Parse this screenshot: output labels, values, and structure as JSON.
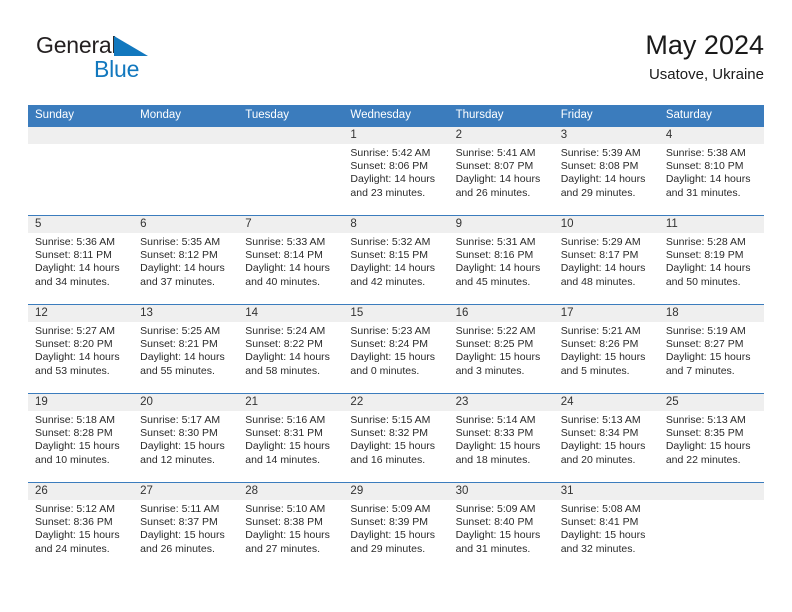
{
  "brand": {
    "name_part1": "General",
    "name_part2": "Blue",
    "triangle_color": "#1278be"
  },
  "header": {
    "title": "May 2024",
    "subtitle": "Usatove, Ukraine"
  },
  "colors": {
    "header_blue": "#3b7cbd",
    "day_number_band": "#efefef",
    "brand_blue": "#1278be",
    "text": "#222222"
  },
  "weekdays": [
    "Sunday",
    "Monday",
    "Tuesday",
    "Wednesday",
    "Thursday",
    "Friday",
    "Saturday"
  ],
  "labels": {
    "sunrise": "Sunrise:",
    "sunset": "Sunset:",
    "daylight": "Daylight:"
  },
  "weeks": [
    [
      {
        "day": "",
        "sunrise": "",
        "sunset": "",
        "daylight_line1": "",
        "daylight_line2": "",
        "empty": true
      },
      {
        "day": "",
        "sunrise": "",
        "sunset": "",
        "daylight_line1": "",
        "daylight_line2": "",
        "empty": true
      },
      {
        "day": "",
        "sunrise": "",
        "sunset": "",
        "daylight_line1": "",
        "daylight_line2": "",
        "empty": true
      },
      {
        "day": "1",
        "sunrise": "Sunrise: 5:42 AM",
        "sunset": "Sunset: 8:06 PM",
        "daylight_line1": "Daylight: 14 hours",
        "daylight_line2": "and 23 minutes.",
        "empty": false
      },
      {
        "day": "2",
        "sunrise": "Sunrise: 5:41 AM",
        "sunset": "Sunset: 8:07 PM",
        "daylight_line1": "Daylight: 14 hours",
        "daylight_line2": "and 26 minutes.",
        "empty": false
      },
      {
        "day": "3",
        "sunrise": "Sunrise: 5:39 AM",
        "sunset": "Sunset: 8:08 PM",
        "daylight_line1": "Daylight: 14 hours",
        "daylight_line2": "and 29 minutes.",
        "empty": false
      },
      {
        "day": "4",
        "sunrise": "Sunrise: 5:38 AM",
        "sunset": "Sunset: 8:10 PM",
        "daylight_line1": "Daylight: 14 hours",
        "daylight_line2": "and 31 minutes.",
        "empty": false
      }
    ],
    [
      {
        "day": "5",
        "sunrise": "Sunrise: 5:36 AM",
        "sunset": "Sunset: 8:11 PM",
        "daylight_line1": "Daylight: 14 hours",
        "daylight_line2": "and 34 minutes.",
        "empty": false
      },
      {
        "day": "6",
        "sunrise": "Sunrise: 5:35 AM",
        "sunset": "Sunset: 8:12 PM",
        "daylight_line1": "Daylight: 14 hours",
        "daylight_line2": "and 37 minutes.",
        "empty": false
      },
      {
        "day": "7",
        "sunrise": "Sunrise: 5:33 AM",
        "sunset": "Sunset: 8:14 PM",
        "daylight_line1": "Daylight: 14 hours",
        "daylight_line2": "and 40 minutes.",
        "empty": false
      },
      {
        "day": "8",
        "sunrise": "Sunrise: 5:32 AM",
        "sunset": "Sunset: 8:15 PM",
        "daylight_line1": "Daylight: 14 hours",
        "daylight_line2": "and 42 minutes.",
        "empty": false
      },
      {
        "day": "9",
        "sunrise": "Sunrise: 5:31 AM",
        "sunset": "Sunset: 8:16 PM",
        "daylight_line1": "Daylight: 14 hours",
        "daylight_line2": "and 45 minutes.",
        "empty": false
      },
      {
        "day": "10",
        "sunrise": "Sunrise: 5:29 AM",
        "sunset": "Sunset: 8:17 PM",
        "daylight_line1": "Daylight: 14 hours",
        "daylight_line2": "and 48 minutes.",
        "empty": false
      },
      {
        "day": "11",
        "sunrise": "Sunrise: 5:28 AM",
        "sunset": "Sunset: 8:19 PM",
        "daylight_line1": "Daylight: 14 hours",
        "daylight_line2": "and 50 minutes.",
        "empty": false
      }
    ],
    [
      {
        "day": "12",
        "sunrise": "Sunrise: 5:27 AM",
        "sunset": "Sunset: 8:20 PM",
        "daylight_line1": "Daylight: 14 hours",
        "daylight_line2": "and 53 minutes.",
        "empty": false
      },
      {
        "day": "13",
        "sunrise": "Sunrise: 5:25 AM",
        "sunset": "Sunset: 8:21 PM",
        "daylight_line1": "Daylight: 14 hours",
        "daylight_line2": "and 55 minutes.",
        "empty": false
      },
      {
        "day": "14",
        "sunrise": "Sunrise: 5:24 AM",
        "sunset": "Sunset: 8:22 PM",
        "daylight_line1": "Daylight: 14 hours",
        "daylight_line2": "and 58 minutes.",
        "empty": false
      },
      {
        "day": "15",
        "sunrise": "Sunrise: 5:23 AM",
        "sunset": "Sunset: 8:24 PM",
        "daylight_line1": "Daylight: 15 hours",
        "daylight_line2": "and 0 minutes.",
        "empty": false
      },
      {
        "day": "16",
        "sunrise": "Sunrise: 5:22 AM",
        "sunset": "Sunset: 8:25 PM",
        "daylight_line1": "Daylight: 15 hours",
        "daylight_line2": "and 3 minutes.",
        "empty": false
      },
      {
        "day": "17",
        "sunrise": "Sunrise: 5:21 AM",
        "sunset": "Sunset: 8:26 PM",
        "daylight_line1": "Daylight: 15 hours",
        "daylight_line2": "and 5 minutes.",
        "empty": false
      },
      {
        "day": "18",
        "sunrise": "Sunrise: 5:19 AM",
        "sunset": "Sunset: 8:27 PM",
        "daylight_line1": "Daylight: 15 hours",
        "daylight_line2": "and 7 minutes.",
        "empty": false
      }
    ],
    [
      {
        "day": "19",
        "sunrise": "Sunrise: 5:18 AM",
        "sunset": "Sunset: 8:28 PM",
        "daylight_line1": "Daylight: 15 hours",
        "daylight_line2": "and 10 minutes.",
        "empty": false
      },
      {
        "day": "20",
        "sunrise": "Sunrise: 5:17 AM",
        "sunset": "Sunset: 8:30 PM",
        "daylight_line1": "Daylight: 15 hours",
        "daylight_line2": "and 12 minutes.",
        "empty": false
      },
      {
        "day": "21",
        "sunrise": "Sunrise: 5:16 AM",
        "sunset": "Sunset: 8:31 PM",
        "daylight_line1": "Daylight: 15 hours",
        "daylight_line2": "and 14 minutes.",
        "empty": false
      },
      {
        "day": "22",
        "sunrise": "Sunrise: 5:15 AM",
        "sunset": "Sunset: 8:32 PM",
        "daylight_line1": "Daylight: 15 hours",
        "daylight_line2": "and 16 minutes.",
        "empty": false
      },
      {
        "day": "23",
        "sunrise": "Sunrise: 5:14 AM",
        "sunset": "Sunset: 8:33 PM",
        "daylight_line1": "Daylight: 15 hours",
        "daylight_line2": "and 18 minutes.",
        "empty": false
      },
      {
        "day": "24",
        "sunrise": "Sunrise: 5:13 AM",
        "sunset": "Sunset: 8:34 PM",
        "daylight_line1": "Daylight: 15 hours",
        "daylight_line2": "and 20 minutes.",
        "empty": false
      },
      {
        "day": "25",
        "sunrise": "Sunrise: 5:13 AM",
        "sunset": "Sunset: 8:35 PM",
        "daylight_line1": "Daylight: 15 hours",
        "daylight_line2": "and 22 minutes.",
        "empty": false
      }
    ],
    [
      {
        "day": "26",
        "sunrise": "Sunrise: 5:12 AM",
        "sunset": "Sunset: 8:36 PM",
        "daylight_line1": "Daylight: 15 hours",
        "daylight_line2": "and 24 minutes.",
        "empty": false
      },
      {
        "day": "27",
        "sunrise": "Sunrise: 5:11 AM",
        "sunset": "Sunset: 8:37 PM",
        "daylight_line1": "Daylight: 15 hours",
        "daylight_line2": "and 26 minutes.",
        "empty": false
      },
      {
        "day": "28",
        "sunrise": "Sunrise: 5:10 AM",
        "sunset": "Sunset: 8:38 PM",
        "daylight_line1": "Daylight: 15 hours",
        "daylight_line2": "and 27 minutes.",
        "empty": false
      },
      {
        "day": "29",
        "sunrise": "Sunrise: 5:09 AM",
        "sunset": "Sunset: 8:39 PM",
        "daylight_line1": "Daylight: 15 hours",
        "daylight_line2": "and 29 minutes.",
        "empty": false
      },
      {
        "day": "30",
        "sunrise": "Sunrise: 5:09 AM",
        "sunset": "Sunset: 8:40 PM",
        "daylight_line1": "Daylight: 15 hours",
        "daylight_line2": "and 31 minutes.",
        "empty": false
      },
      {
        "day": "31",
        "sunrise": "Sunrise: 5:08 AM",
        "sunset": "Sunset: 8:41 PM",
        "daylight_line1": "Daylight: 15 hours",
        "daylight_line2": "and 32 minutes.",
        "empty": false
      },
      {
        "day": "",
        "sunrise": "",
        "sunset": "",
        "daylight_line1": "",
        "daylight_line2": "",
        "empty": true
      }
    ]
  ]
}
